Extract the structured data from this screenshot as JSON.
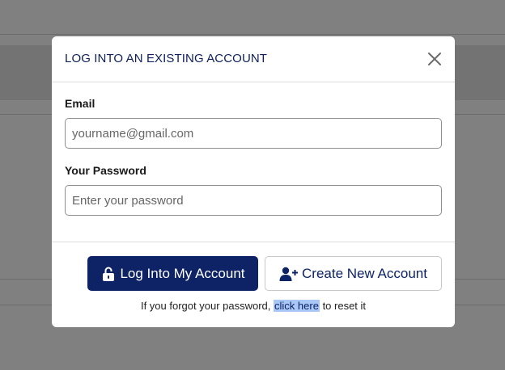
{
  "modal": {
    "title": "LOG INTO AN EXISTING ACCOUNT",
    "close_icon": "close-icon"
  },
  "form": {
    "email_label": "Email",
    "email_placeholder": "yourname@gmail.com",
    "email_value": "",
    "password_label": "Your Password",
    "password_placeholder": "Enter your password",
    "password_value": ""
  },
  "actions": {
    "login_label": "Log Into My Account",
    "login_icon": "unlock-icon",
    "create_label": "Create New Account",
    "create_icon": "user-plus-icon"
  },
  "forgot": {
    "prefix": "If you forgot your password,",
    "link": "click here",
    "suffix": "to reset it"
  },
  "colors": {
    "primary": "#0d2366",
    "title": "#0e1f5b",
    "link_highlight": "#a9c8f5",
    "overlay": "#808080"
  }
}
